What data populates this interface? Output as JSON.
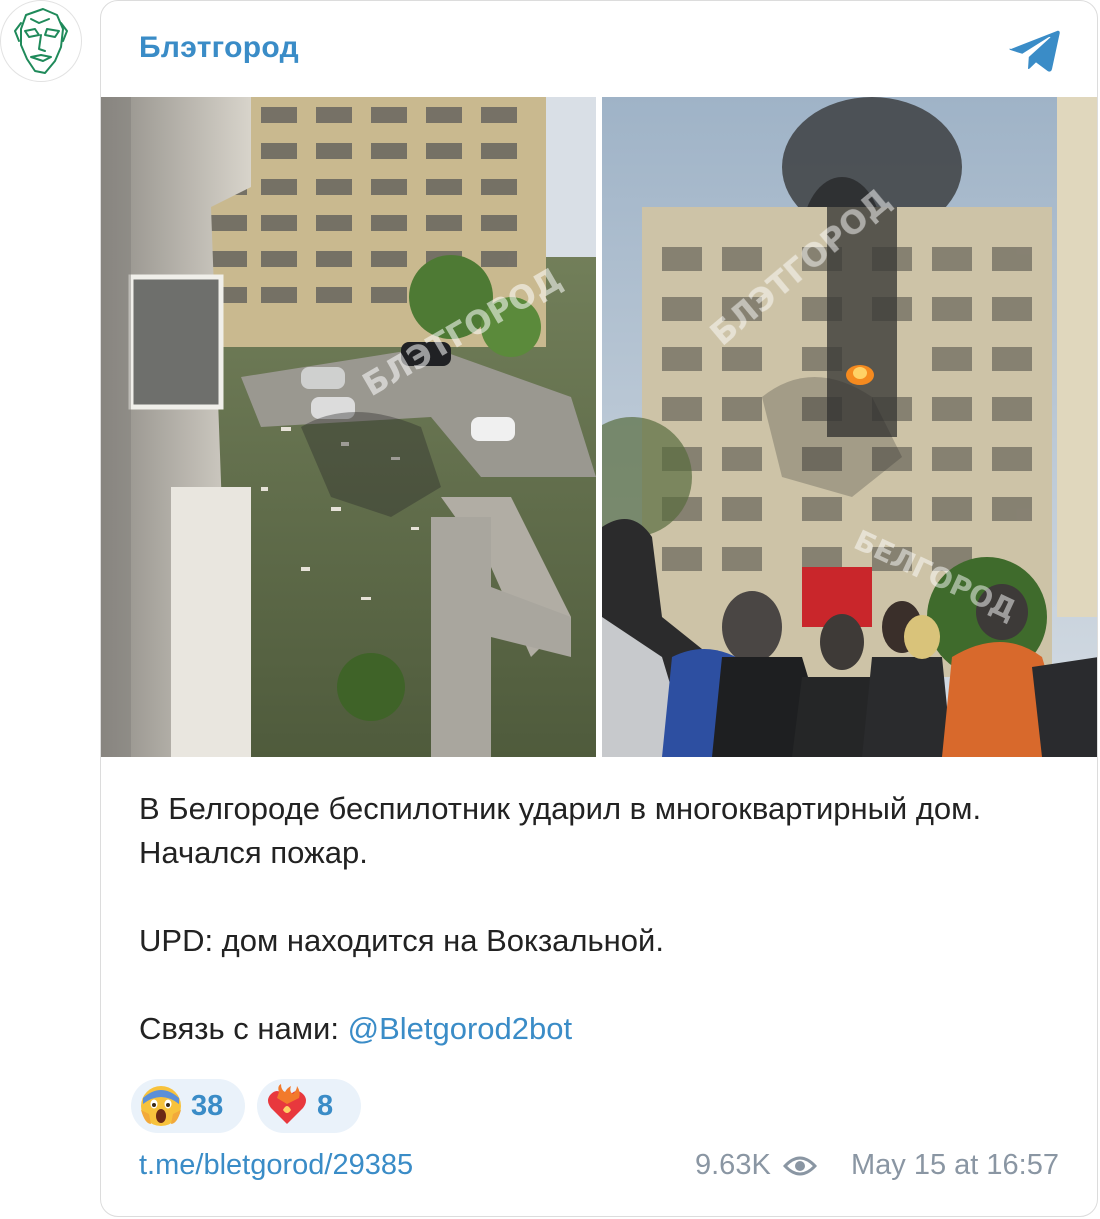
{
  "channel": {
    "name": "Блэтгород"
  },
  "message": {
    "paragraph1": "В Белгороде беспилотник ударил в многоквартирный дом. Начался пожар.",
    "paragraph2": "UPD: дом находится на Вокзальной.",
    "contact_prefix": "Связь с нами: ",
    "contact_mention": "@Bletgorod2bot"
  },
  "media": {
    "watermark_text": "БЛЭТГОРОД",
    "watermark_text_alt": "БЕЛГОРОД"
  },
  "reactions": [
    {
      "icon": "scream-emoji-icon",
      "count": "38"
    },
    {
      "icon": "heart-on-fire-emoji-icon",
      "count": "8"
    }
  ],
  "footer": {
    "link": "t.me/bletgorod/29385",
    "views": "9.63K",
    "date": "May 15 at 16:57"
  },
  "colors": {
    "accent": "#3a8cc7",
    "meta": "#8a96a3",
    "reaction_bg": "#eaf2fa"
  }
}
